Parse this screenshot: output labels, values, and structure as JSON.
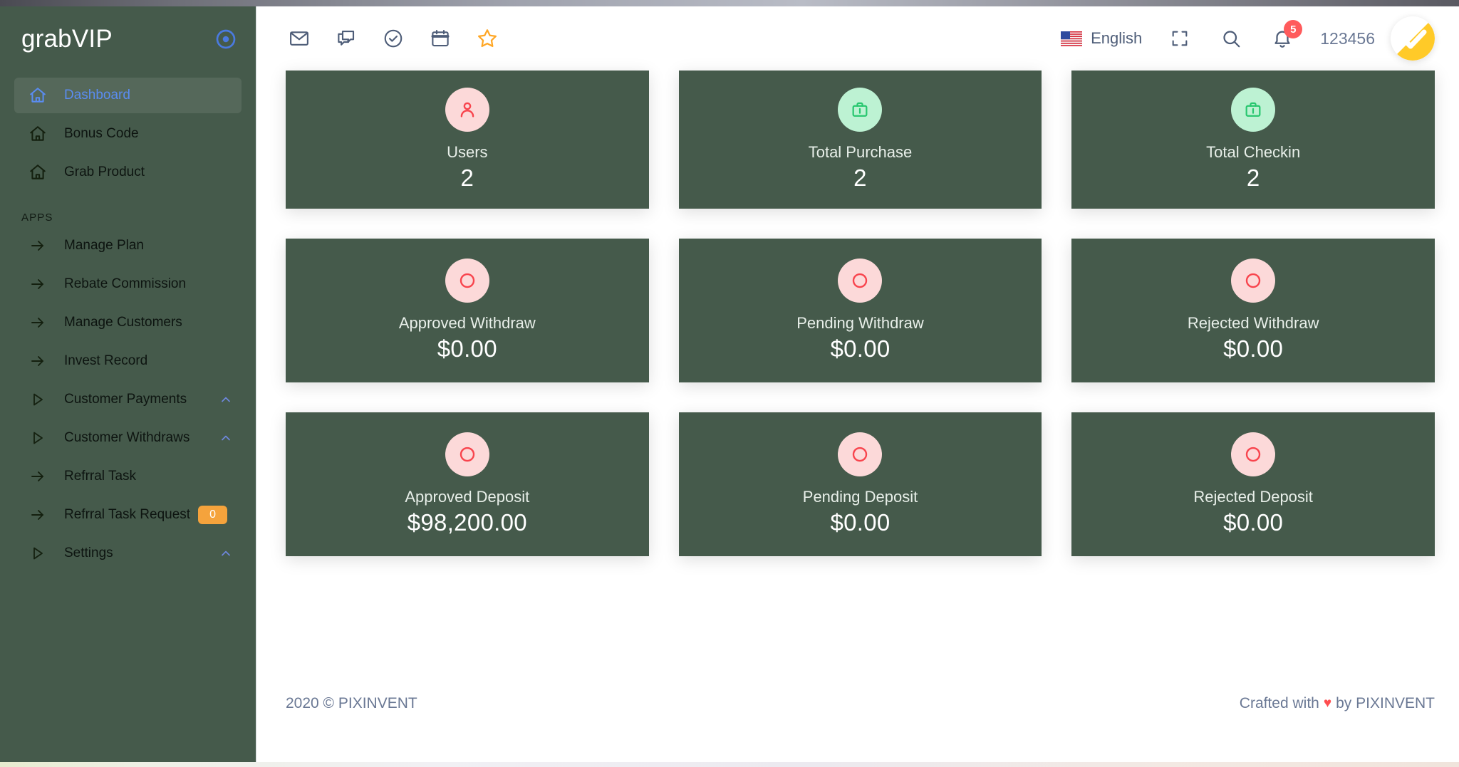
{
  "brand": {
    "name": "grabVIP",
    "logo_icon": "target-disc-icon"
  },
  "sidebar": {
    "section_label": "APPS",
    "top_items": [
      {
        "label": "Dashboard",
        "icon": "home-icon",
        "active": true
      },
      {
        "label": "Bonus Code",
        "icon": "home-icon",
        "active": false
      },
      {
        "label": "Grab Product",
        "icon": "home-icon",
        "active": false
      }
    ],
    "app_items": [
      {
        "label": "Manage Plan",
        "icon": "arrow-right-icon",
        "caret": false,
        "badge": null
      },
      {
        "label": "Rebate Commission",
        "icon": "arrow-right-icon",
        "caret": false,
        "badge": null
      },
      {
        "label": "Manage Customers",
        "icon": "arrow-right-icon",
        "caret": false,
        "badge": null
      },
      {
        "label": "Invest Record",
        "icon": "arrow-right-icon",
        "caret": false,
        "badge": null
      },
      {
        "label": "Customer Payments",
        "icon": "play-triangle-icon",
        "caret": true,
        "badge": null
      },
      {
        "label": "Customer Withdraws",
        "icon": "play-triangle-icon",
        "caret": true,
        "badge": null
      },
      {
        "label": "Refrral Task",
        "icon": "arrow-right-icon",
        "caret": false,
        "badge": null
      },
      {
        "label": "Refrral Task Request",
        "icon": "arrow-right-icon",
        "caret": false,
        "badge": "0"
      },
      {
        "label": "Settings",
        "icon": "play-triangle-icon",
        "caret": true,
        "badge": null
      }
    ]
  },
  "navbar": {
    "left_icons": [
      {
        "name": "mail-icon"
      },
      {
        "name": "chat-icon"
      },
      {
        "name": "check-circle-icon"
      },
      {
        "name": "calendar-icon"
      },
      {
        "name": "star-icon"
      }
    ],
    "language": "English",
    "flag": "us-flag-icon",
    "fullscreen_icon": "fullscreen-icon",
    "search_icon": "search-icon",
    "bell_icon": "bell-icon",
    "notification_count": "5",
    "username": "123456",
    "avatar_icon": "check-avatar-icon"
  },
  "cards": [
    {
      "title": "Users",
      "value": "2",
      "icon": "user-icon",
      "icon_style": "pink"
    },
    {
      "title": "Total Purchase",
      "value": "2",
      "icon": "briefcase-icon",
      "icon_style": "green"
    },
    {
      "title": "Total Checkin",
      "value": "2",
      "icon": "briefcase-icon",
      "icon_style": "green"
    },
    {
      "title": "Approved Withdraw",
      "value": "$0.00",
      "icon": "circle-icon",
      "icon_style": "pink"
    },
    {
      "title": "Pending Withdraw",
      "value": "$0.00",
      "icon": "circle-icon",
      "icon_style": "pink"
    },
    {
      "title": "Rejected Withdraw",
      "value": "$0.00",
      "icon": "circle-icon",
      "icon_style": "pink"
    },
    {
      "title": "Approved Deposit",
      "value": "$98,200.00",
      "icon": "circle-icon",
      "icon_style": "pink"
    },
    {
      "title": "Pending Deposit",
      "value": "$0.00",
      "icon": "circle-icon",
      "icon_style": "pink"
    },
    {
      "title": "Rejected Deposit",
      "value": "$0.00",
      "icon": "circle-icon",
      "icon_style": "pink"
    }
  ],
  "footer": {
    "left": "2020 © PIXINVENT",
    "right_prefix": "Crafted with",
    "heart": "♥",
    "right_suffix": "by PIXINVENT"
  },
  "colors": {
    "sidebar_green": "#455A4B",
    "card_green": "#455A4B",
    "accent_blue": "#5a8cf0",
    "badge_orange": "#f5a33c",
    "notification_red": "#ff5b5c",
    "icon_pink_bg": "#fcd9d9",
    "icon_red": "#f8444d",
    "icon_green_bg": "#bdf2d3",
    "icon_green": "#28c76f",
    "avatar_yellow": "#ffca28",
    "star_orange": "#ffa726",
    "nav_icon_slate": "#4e5d78"
  }
}
